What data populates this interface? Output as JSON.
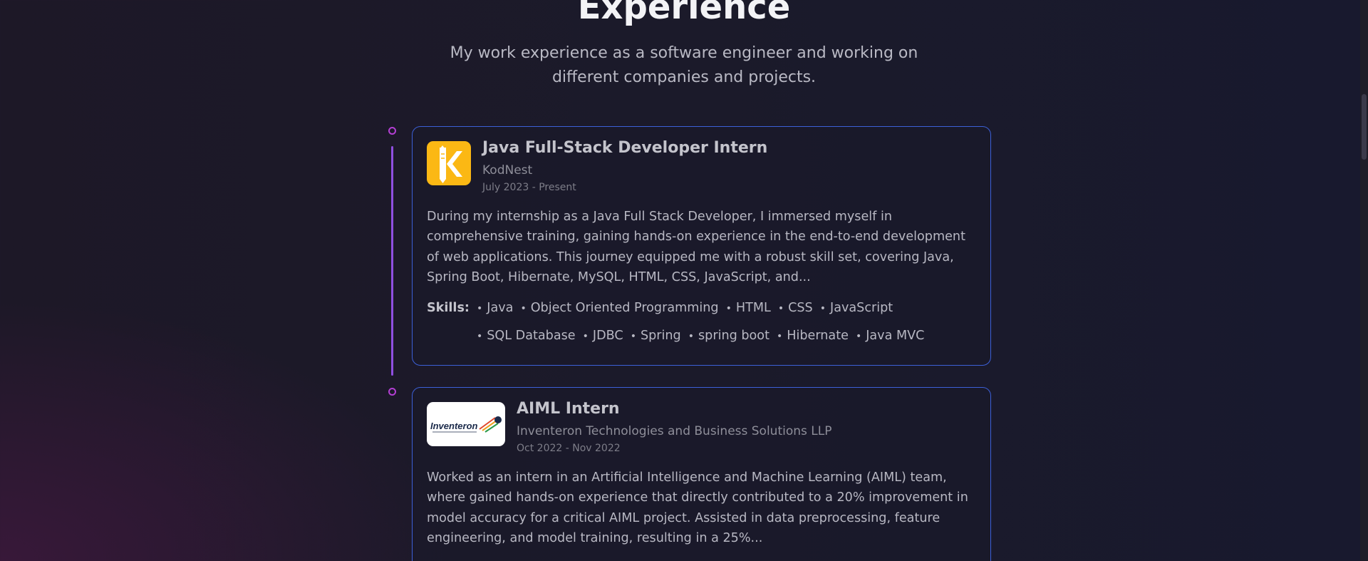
{
  "section": {
    "title": "Experience",
    "subtitle": "My work experience as a software engineer and working on different companies and projects."
  },
  "experiences": [
    {
      "role": "Java Full-Stack Developer Intern",
      "company": "KodNest",
      "dates": "July 2023 - Present",
      "logo_icon": "kodnest-logo-icon",
      "logo_color": "#fbb814",
      "description": "During my internship as a Java Full Stack Developer, I immersed myself in comprehensive training, gaining hands-on experience in the end-to-end development of web applications. This journey equipped me with a robust skill set, covering Java, Spring Boot, Hibernate, MySQL, HTML, CSS, JavaScript, and...",
      "skills_label": "Skills:",
      "skills": [
        "Java",
        "Object Oriented Programming",
        "HTML",
        "CSS",
        "JavaScript",
        "SQL Database",
        "JDBC",
        "Spring",
        "spring boot",
        "Hibernate",
        "Java MVC"
      ]
    },
    {
      "role": "AIML Intern",
      "company": "Inventeron Technologies and Business Solutions LLP",
      "dates": "Oct 2022 - Nov 2022",
      "logo_icon": "inventeron-logo-icon",
      "logo_text": "Inventeron",
      "description": "Worked as an intern in an Artificial Intelligence and Machine Learning (AIML) team, where gained hands-on experience that directly contributed to a 20% improvement in model accuracy for a critical AIML project. Assisted in data preprocessing, feature engineering, and model training, resulting in a 25%..."
    }
  ],
  "colors": {
    "card_border": "#3c60d8",
    "timeline_line": "#8f4fe0",
    "timeline_dot": "#b33fd3"
  }
}
